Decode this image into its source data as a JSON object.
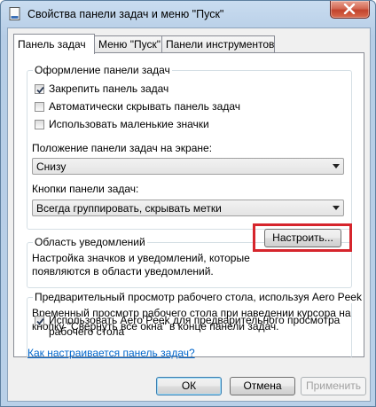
{
  "window": {
    "title": "Свойства панели задач и меню \"Пуск\""
  },
  "tabs": [
    {
      "label": "Панель задач",
      "active": true
    },
    {
      "label": "Меню \"Пуск\"",
      "active": false
    },
    {
      "label": "Панели инструментов",
      "active": false
    }
  ],
  "appearance": {
    "group_label": "Оформление панели задач",
    "checkboxes": [
      {
        "label": "Закрепить панель задач",
        "checked": true
      },
      {
        "label": "Автоматически скрывать панель задач",
        "checked": false
      },
      {
        "label": "Использовать маленькие значки",
        "checked": false
      }
    ],
    "position_label": "Положение панели задач на экране:",
    "position_value": "Снизу",
    "buttons_label": "Кнопки панели задач:",
    "buttons_value": "Всегда группировать, скрывать метки"
  },
  "notification_area": {
    "group_label": "Область уведомлений",
    "description_line1": "Настройка значков и уведомлений, которые",
    "description_line2": "появляются в области уведомлений.",
    "customize_button": "Настроить..."
  },
  "aero_peek": {
    "group_label": "Предварительный просмотр рабочего стола, используя Aero Peek",
    "description_line1": "Временный просмотр рабочего стола при наведении курсора на",
    "description_line2": "кнопку \"Свернуть все окна\" в конце панели задач.",
    "checkbox_line1": "Использовать Aero Peek для предварительного просмотра",
    "checkbox_line2": "рабочего стола",
    "checkbox_checked": true
  },
  "help_link": "Как настраивается панель задач?",
  "footer": {
    "ok": "ОК",
    "cancel": "Отмена",
    "apply": "Применить"
  },
  "colors": {
    "highlight": "#d6252c",
    "link": "#0066cc"
  }
}
